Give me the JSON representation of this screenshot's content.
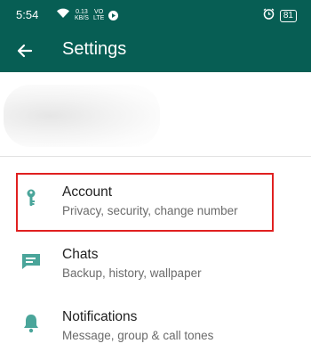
{
  "status_bar": {
    "time": "5:54",
    "network_speed_line1": "0.13",
    "network_speed_line2": "KB/S",
    "volte_line1": "VO",
    "volte_line2": "LTE",
    "battery": "81"
  },
  "app_bar": {
    "title": "Settings"
  },
  "menu": [
    {
      "title": "Account",
      "subtitle": "Privacy, security, change number",
      "icon": "key-icon"
    },
    {
      "title": "Chats",
      "subtitle": "Backup, history, wallpaper",
      "icon": "chat-icon"
    },
    {
      "title": "Notifications",
      "subtitle": "Message, group & call tones",
      "icon": "bell-icon"
    }
  ],
  "colors": {
    "primary": "#075e54",
    "icon_accent": "#4aa59a",
    "highlight": "#e02020"
  }
}
